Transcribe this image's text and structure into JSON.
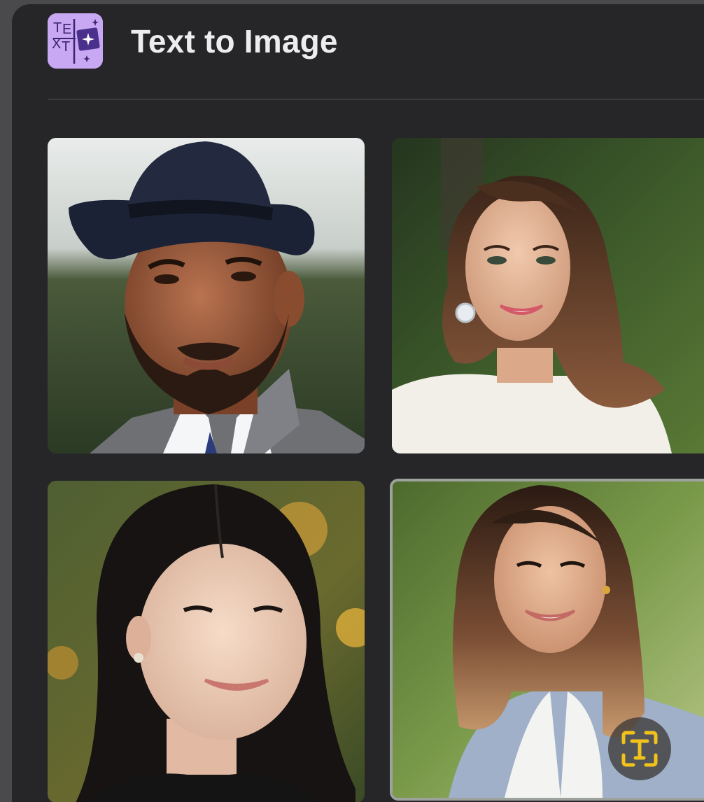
{
  "app": {
    "title": "Text to Image",
    "icon": "text-to-image-app-icon",
    "icon_letters": "TEXT"
  },
  "gallery": {
    "items": [
      {
        "subject": "man-in-fedora-portrait",
        "selected": false
      },
      {
        "subject": "woman-wavy-hair-portrait",
        "selected": false
      },
      {
        "subject": "woman-dark-hair-portrait",
        "selected": false
      },
      {
        "subject": "woman-blazer-portrait",
        "selected": true
      }
    ]
  },
  "overlay": {
    "text_tool_icon": "text-recognition-icon"
  },
  "colors": {
    "panel": "#262629",
    "accent_icon_bg": "#c9a8f3",
    "text_tool_icon": "#f1c21a"
  }
}
